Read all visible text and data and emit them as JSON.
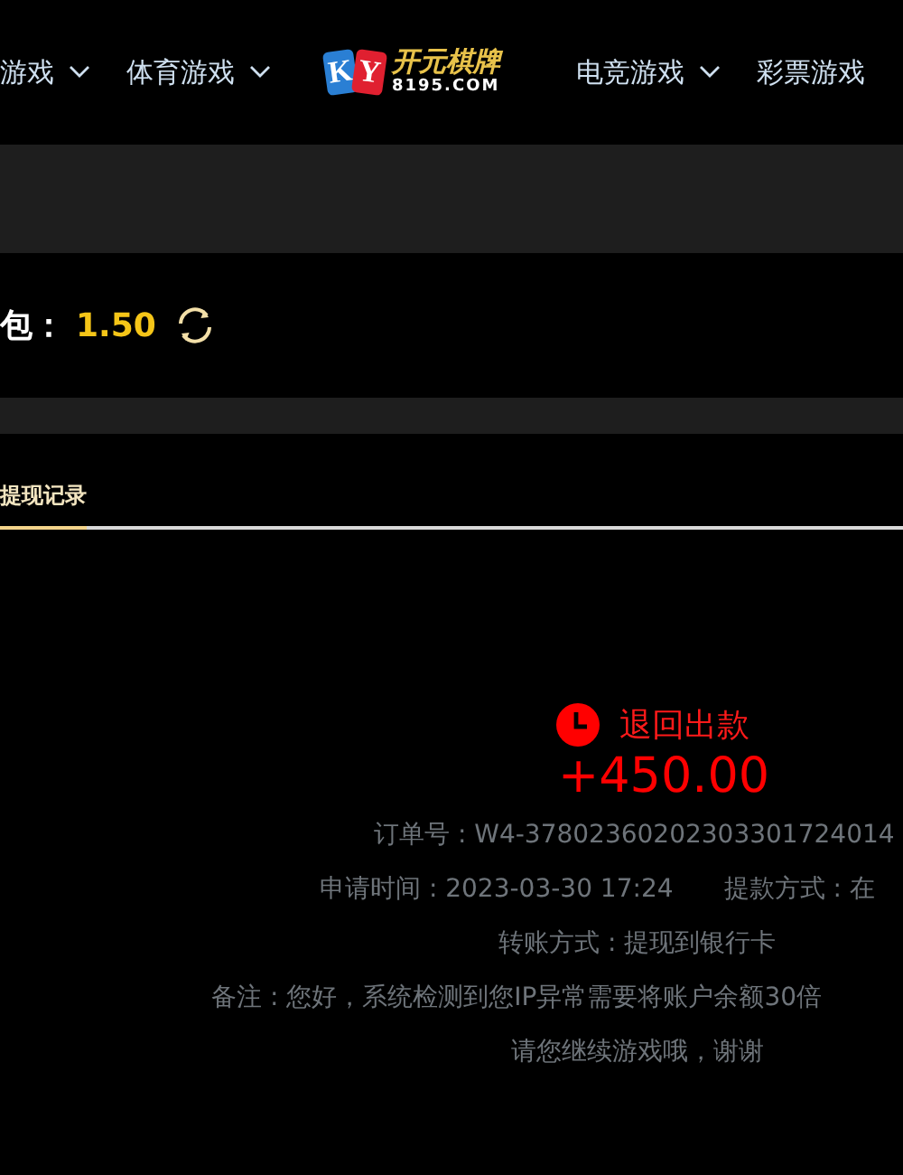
{
  "nav": {
    "items": [
      {
        "label": "游戏",
        "caret": true
      },
      {
        "label": "体育游戏",
        "caret": true
      },
      {
        "kind": "logo",
        "letters": [
          "K",
          "Y"
        ],
        "brand": "开元棋牌",
        "site": "8195.COM"
      },
      {
        "label": "电竞游戏",
        "caret": true
      },
      {
        "label": "彩票游戏",
        "caret": false
      }
    ]
  },
  "balance": {
    "label": "包：",
    "amount": "1.50"
  },
  "tabs": [
    {
      "label": "提现记录",
      "selected": true
    }
  ],
  "record": {
    "status": "退回出款",
    "amount": "+450.00",
    "lines": [
      {
        "kind": "order",
        "text": "订单号 : W4-37802360202303301724014"
      },
      {
        "kind": "time",
        "text": "申请时间 : 2023-03-30 17:24",
        "extra": "提款方式 : 在"
      },
      {
        "kind": "transfer",
        "text": "转账方式 : 提现到银行卡"
      },
      {
        "kind": "note",
        "text": "备注 : 您好，系统检测到您IP异常需要将账户余额30倍"
      },
      {
        "kind": "tail",
        "text": "请您继续游戏哦，谢谢"
      }
    ]
  }
}
